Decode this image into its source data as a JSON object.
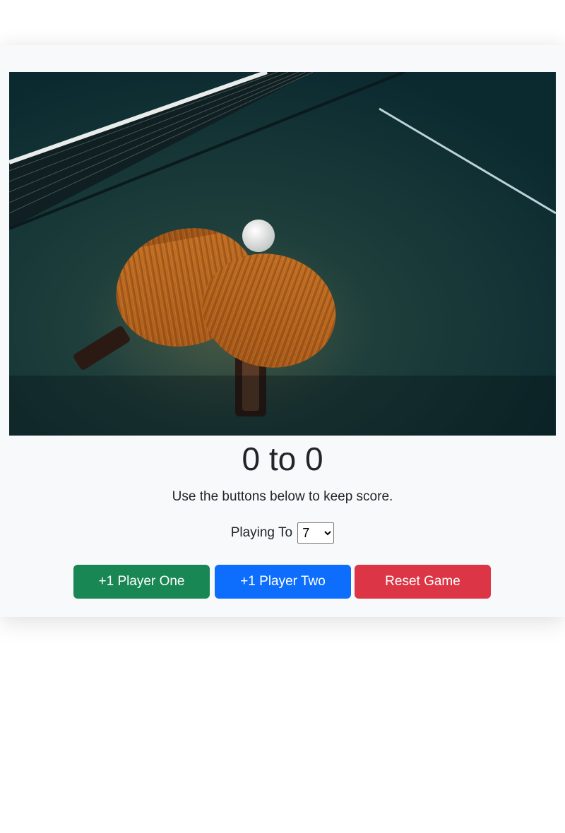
{
  "hero": {
    "description_icon": "ping-pong-paddles-image"
  },
  "scoreboard": {
    "player_one_score": "0",
    "separator": "to",
    "player_two_score": "0"
  },
  "instructions": "Use the buttons below to keep score.",
  "playing_to": {
    "label": "Playing To",
    "selected": "7",
    "options": [
      "7"
    ]
  },
  "buttons": {
    "player_one": "+1 Player One",
    "player_two": "+1 Player Two",
    "reset": "Reset Game"
  },
  "colors": {
    "player_one": "#198754",
    "player_two": "#0d6efd",
    "reset": "#dc3545"
  }
}
